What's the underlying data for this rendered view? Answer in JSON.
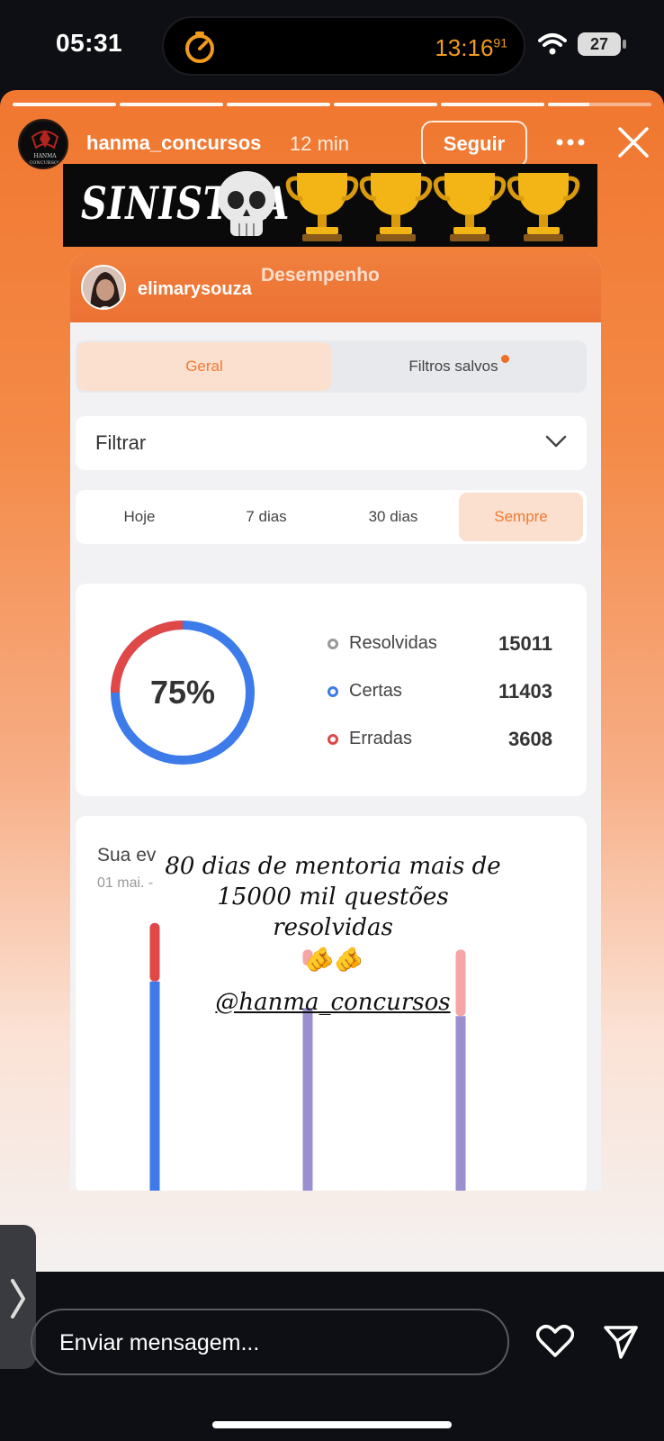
{
  "status_bar": {
    "time": "05:31",
    "timer": "13:16",
    "timer_fraction": "91",
    "battery": "27",
    "icons": [
      "timer-icon",
      "wifi-icon",
      "battery-icon"
    ]
  },
  "story": {
    "progress_segments": 6,
    "progress_current_fraction": 0.4,
    "username": "hanma_concursos",
    "time_ago": "12 min",
    "follow_label": "Seguir",
    "banner_text": "SINISTRA",
    "banner_emojis": "💀🏆🏆🏆🏆",
    "avatar_text": "HANMA CONCURSOS"
  },
  "card": {
    "username": "elimarysouza",
    "title": "Desempenho",
    "tabs": [
      "Geral",
      "Filtros salvos"
    ],
    "active_tab": "Geral",
    "filter_label": "Filtrar",
    "periods": [
      "Hoje",
      "7 dias",
      "30 dias",
      "Sempre"
    ],
    "active_period": "Sempre",
    "stats": {
      "percent": "75%",
      "rows": [
        {
          "label": "Resolvidas",
          "value": "15011"
        },
        {
          "label": "Certas",
          "value": "11403"
        },
        {
          "label": "Erradas",
          "value": "3608"
        }
      ]
    },
    "evolution_title": "Sua ev",
    "evolution_date": "01 mai. -"
  },
  "chart_data": {
    "type": "bar",
    "stacked": true,
    "categories": [
      "",
      "",
      ""
    ],
    "series": [
      {
        "name": "",
        "values": [
          80,
          70,
          67
        ],
        "colors": [
          "#3d7bea",
          "#9b8fd0",
          "#9b8fd0"
        ]
      },
      {
        "name": "",
        "values": [
          22,
          6,
          25
        ],
        "colors": [
          "#e04848",
          "#f5a5a5",
          "#f5a5a5"
        ]
      }
    ],
    "gap_below_top": [
      0,
      16,
      0
    ],
    "xlabel": "",
    "ylabel": ""
  },
  "overlay": {
    "line1": "80 dias de mentoria mais de",
    "line2": "15000 mil questões resolvidas",
    "emoji": "🫵🫵",
    "tag": "@hanma_concursos"
  },
  "composer": {
    "placeholder": "Enviar mensagem..."
  },
  "colors": {
    "accent": "#ef7b34",
    "correct": "#3d7bea",
    "wrong": "#e04848"
  }
}
